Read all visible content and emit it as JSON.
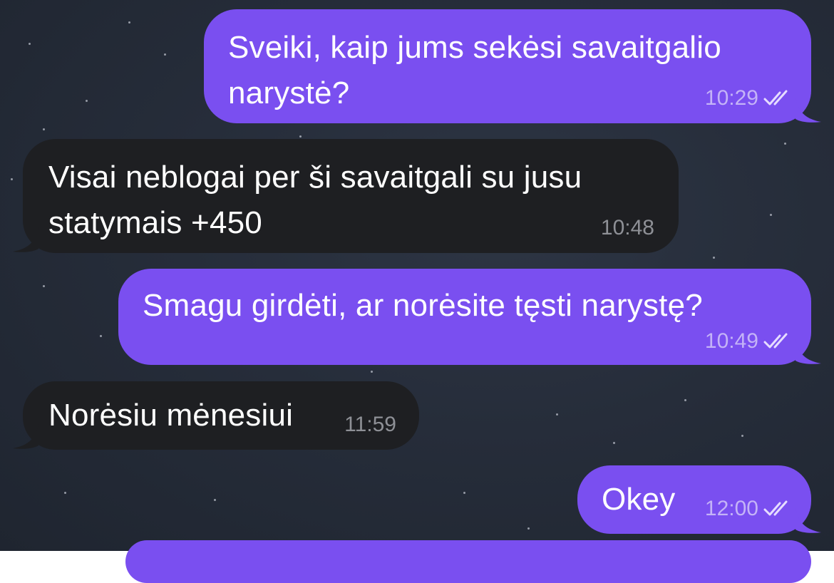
{
  "messages": [
    {
      "direction": "outgoing",
      "text": "Sveiki, kaip jums sekėsi savaitgalio\nnarystė?",
      "time": "10:29",
      "status": "read"
    },
    {
      "direction": "incoming",
      "text": "Visai neblogai per ši savaitgali su jusu\nstatymais +450",
      "time": "10:48"
    },
    {
      "direction": "outgoing",
      "text": "Smagu girdėti, ar norėsite tęsti narystę?",
      "time": "10:49",
      "status": "read"
    },
    {
      "direction": "incoming",
      "text": "Norėsiu mėnesiui",
      "time": "11:59"
    },
    {
      "direction": "outgoing",
      "text": "Okey",
      "time": "12:00",
      "status": "read"
    }
  ],
  "colors": {
    "outgoing_bubble": "#7a4ff0",
    "incoming_bubble": "#1e1f22",
    "background": "#262d3a"
  },
  "icons": {
    "read_receipt": "double-check-icon"
  }
}
